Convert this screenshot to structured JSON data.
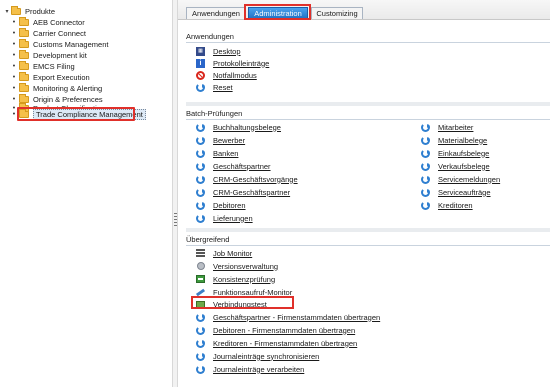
{
  "tree": {
    "root": "Produkte",
    "items": [
      "AEB Connector",
      "Carrier Connect",
      "Customs Management",
      "Development kit",
      "EMCS Filing",
      "Export Execution",
      "Monitoring & Alerting",
      "Origin & Preferences",
      "Product Classification",
      "Trade Compliance Management"
    ],
    "selected": "Trade Compliance Management"
  },
  "tabs": [
    {
      "label": "Anwendungen",
      "active": false
    },
    {
      "label": "Administration",
      "active": true
    },
    {
      "label": "Customizing",
      "active": false
    }
  ],
  "sections": {
    "anwendungen": {
      "title": "Anwendungen",
      "items": [
        {
          "label": "Desktop",
          "icon": "desktop-icon"
        },
        {
          "label": "Protokolleinträge",
          "icon": "info-icon"
        },
        {
          "label": "Notfallmodus",
          "icon": "no-entry-icon"
        },
        {
          "label": "Reset",
          "icon": "refresh-icon"
        }
      ]
    },
    "batch": {
      "title": "Batch-Prüfungen",
      "left": [
        "Buchhaltungsbelege",
        "Bewerber",
        "Banken",
        "Geschäftspartner",
        "CRM-Geschäftsvorgänge",
        "CRM-Geschäftspartner",
        "Debitoren",
        "Lieferungen"
      ],
      "right": [
        "Mitarbeiter",
        "Materialbelege",
        "Einkaufsbelege",
        "Verkaufsbelege",
        "Servicemeldungen",
        "Serviceaufträge",
        "Kreditoren"
      ]
    },
    "uebergreifend": {
      "title": "Übergreifend",
      "items": [
        {
          "label": "Job Monitor",
          "icon": "job-icon"
        },
        {
          "label": "Versionsverwaltung",
          "icon": "gear-icon"
        },
        {
          "label": "Konsistenzprüfung",
          "icon": "monitor-icon"
        },
        {
          "label": "Funktionsaufruf-Monitor",
          "icon": "pencil-icon"
        },
        {
          "label": "Verbindungstest",
          "icon": "envelope-icon"
        },
        {
          "label": "Geschäftspartner - Firmenstammdaten übertragen",
          "icon": "refresh-icon"
        },
        {
          "label": "Debitoren - Firmenstammdaten übertragen",
          "icon": "refresh-icon"
        },
        {
          "label": "Kreditoren - Firmenstammdaten übertragen",
          "icon": "refresh-icon"
        },
        {
          "label": "Journaleinträge synchronisieren",
          "icon": "refresh-icon"
        },
        {
          "label": "Journaleinträge verarbeiten",
          "icon": "refresh-icon"
        }
      ]
    }
  },
  "colors": {
    "highlight": "#e0302a",
    "tab_active": "#1f6fc2",
    "folder": "#f5c04a",
    "refresh_icon": "#2f7fd0"
  }
}
